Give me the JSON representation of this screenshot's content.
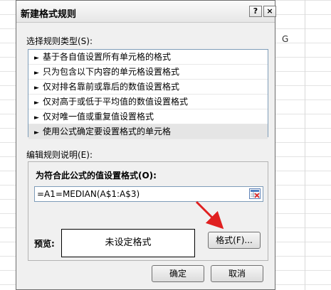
{
  "spreadsheet": {
    "column_header": "G"
  },
  "dialog": {
    "title": "新建格式规则",
    "help_button": "?",
    "close_button": "×",
    "rule_type_label": "选择规则类型(S):",
    "rule_types": [
      "基于各自值设置所有单元格的格式",
      "只为包含以下内容的单元格设置格式",
      "仅对排名靠前或靠后的数值设置格式",
      "仅对高于或低于平均值的数值设置格式",
      "仅对唯一值或重复值设置格式",
      "使用公式确定要设置格式的单元格"
    ],
    "selected_rule_index": 5,
    "edit_description_label": "编辑规则说明(E):",
    "formula_label": "为符合此公式的值设置格式(O):",
    "formula_value": "=A1=MEDIAN(A$1:A$3)",
    "preview_label": "预览:",
    "preview_text": "未设定格式",
    "format_button": "格式(F)...",
    "ok_button": "确定",
    "cancel_button": "取消"
  },
  "colors": {
    "annotation_arrow": "#e02020",
    "dialog_bg": "#f0f0f0"
  },
  "icons": {
    "arrow": "triangle-right-icon",
    "ref_picker": "range-select-icon"
  }
}
